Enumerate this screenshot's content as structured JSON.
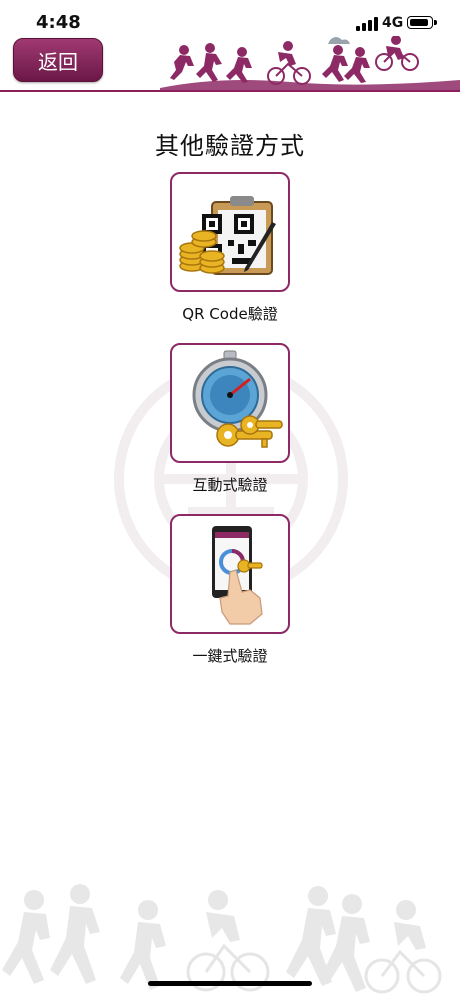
{
  "status_bar": {
    "time": "4:48",
    "network": "4G"
  },
  "header": {
    "back_label": "返回",
    "accent_color": "#8d1f5c"
  },
  "page": {
    "title": "其他驗證方式"
  },
  "options": [
    {
      "label": "QR Code驗證",
      "icon": "qr-code-coins-icon"
    },
    {
      "label": "互動式驗證",
      "icon": "stopwatch-keys-icon"
    },
    {
      "label": "一鍵式驗證",
      "icon": "phone-tap-icon"
    }
  ]
}
